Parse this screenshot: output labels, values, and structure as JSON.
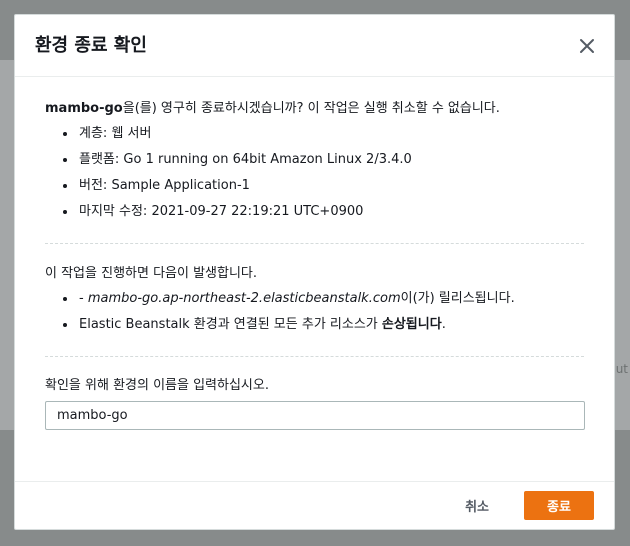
{
  "backdrop": {
    "hint": "ut"
  },
  "dialog": {
    "title": "환경 종료 확인",
    "close_icon": "close-icon",
    "intro": {
      "env_name": "mambo-go",
      "text": "을(를) 영구히 종료하시겠습니까? 이 작업은 실행 취소할 수 없습니다."
    },
    "details": [
      {
        "label": "계층: ",
        "value": "웹 서버"
      },
      {
        "label": "플랫폼: ",
        "value": "Go 1 running on 64bit Amazon Linux 2/3.4.0"
      },
      {
        "label": "버전: ",
        "value": "Sample Application-1"
      },
      {
        "label": "마지막 수정: ",
        "value": "2021-09-27 22:19:21 UTC+0900"
      }
    ],
    "consequences": {
      "lead": "이 작업을 진행하면 다음이 발생합니다.",
      "item1_prefix": "- ",
      "item1_url": "mambo-go.ap-northeast-2.elasticbeanstalk.com",
      "item1_suffix": "이(가) 릴리스됩니다.",
      "item2_text": "Elastic Beanstalk 환경과 연결된 모든 추가 리소스가 ",
      "item2_bold": "손상됩니다",
      "item2_end": "."
    },
    "confirm": {
      "label": "확인을 위해 환경의 이름을 입력하십시오.",
      "value": "mambo-go"
    },
    "footer": {
      "cancel_label": "취소",
      "terminate_label": "종료"
    },
    "colors": {
      "primary": "#ec7211",
      "text": "#16191f",
      "overlay": "#878b8b"
    }
  }
}
